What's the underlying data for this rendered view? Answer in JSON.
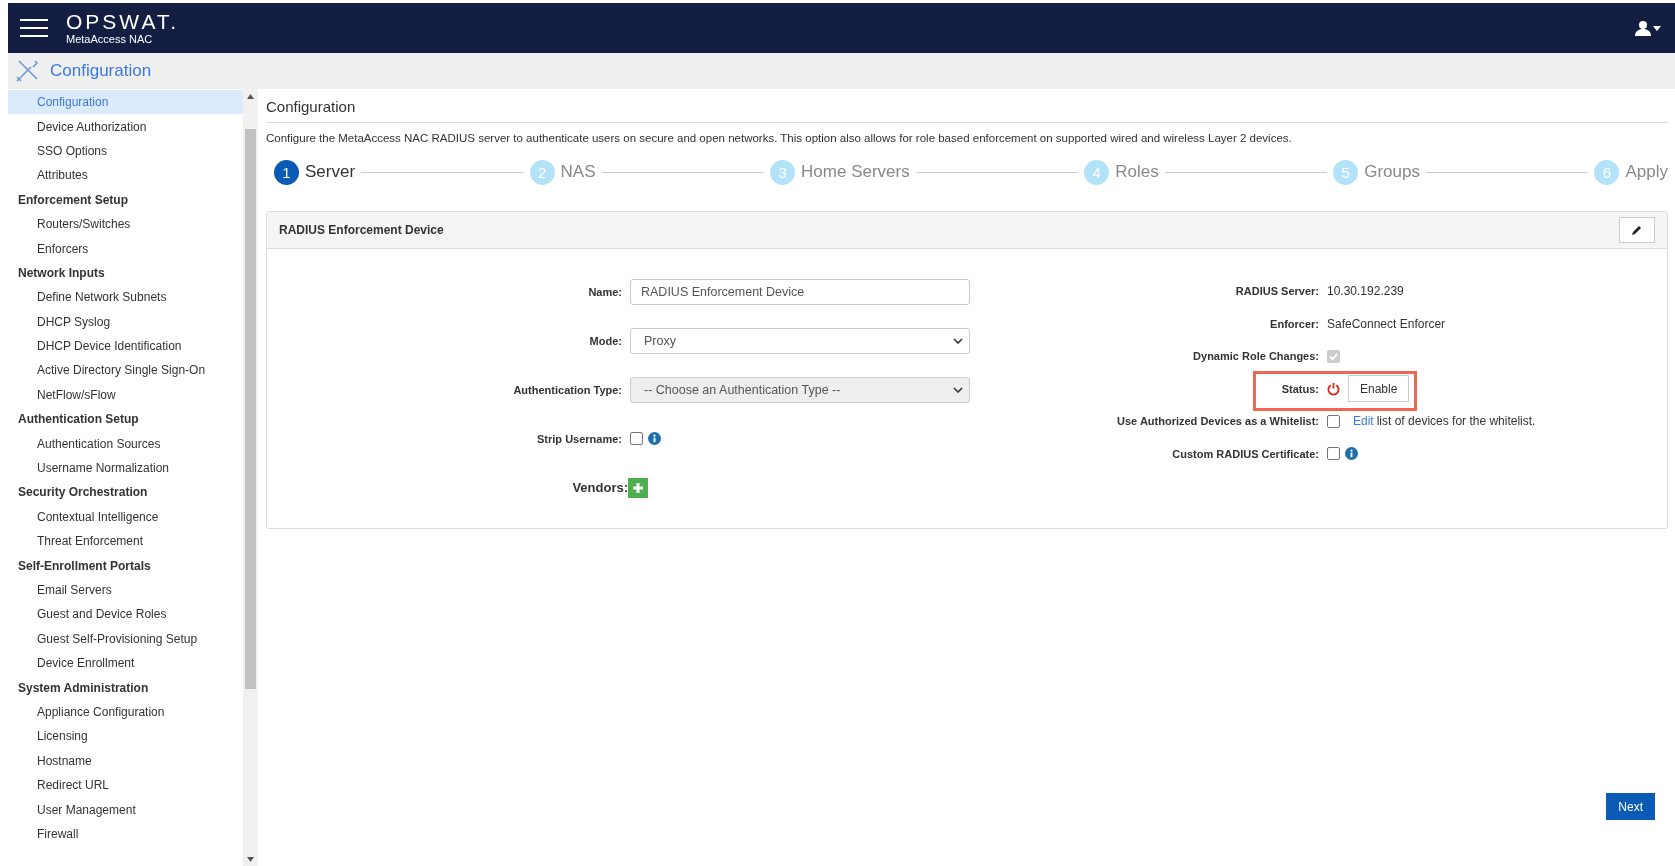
{
  "header": {
    "logo": "OPSWAT.",
    "product": "MetaAccess NAC"
  },
  "section_bar": {
    "title": "Configuration"
  },
  "sidebar": {
    "items": [
      {
        "kind": "item",
        "label": "Configuration",
        "selected": true
      },
      {
        "kind": "item",
        "label": "Device Authorization",
        "selected": false
      },
      {
        "kind": "item",
        "label": "SSO Options",
        "selected": false
      },
      {
        "kind": "item",
        "label": "Attributes",
        "selected": false
      },
      {
        "kind": "group",
        "label": "Enforcement Setup",
        "selected": false
      },
      {
        "kind": "item",
        "label": "Routers/Switches",
        "selected": false
      },
      {
        "kind": "item",
        "label": "Enforcers",
        "selected": false
      },
      {
        "kind": "group",
        "label": "Network Inputs",
        "selected": false
      },
      {
        "kind": "item",
        "label": "Define Network Subnets",
        "selected": false
      },
      {
        "kind": "item",
        "label": "DHCP Syslog",
        "selected": false
      },
      {
        "kind": "item",
        "label": "DHCP Device Identification",
        "selected": false
      },
      {
        "kind": "item",
        "label": "Active Directory Single Sign-On",
        "selected": false
      },
      {
        "kind": "item",
        "label": "NetFlow/sFlow",
        "selected": false
      },
      {
        "kind": "group",
        "label": "Authentication Setup",
        "selected": false
      },
      {
        "kind": "item",
        "label": "Authentication Sources",
        "selected": false
      },
      {
        "kind": "item",
        "label": "Username Normalization",
        "selected": false
      },
      {
        "kind": "group",
        "label": "Security Orchestration",
        "selected": false
      },
      {
        "kind": "item",
        "label": "Contextual Intelligence",
        "selected": false
      },
      {
        "kind": "item",
        "label": "Threat Enforcement",
        "selected": false
      },
      {
        "kind": "group",
        "label": "Self-Enrollment Portals",
        "selected": false
      },
      {
        "kind": "item",
        "label": "Email Servers",
        "selected": false
      },
      {
        "kind": "item",
        "label": "Guest and Device Roles",
        "selected": false
      },
      {
        "kind": "item",
        "label": "Guest Self-Provisioning Setup",
        "selected": false
      },
      {
        "kind": "item",
        "label": "Device Enrollment",
        "selected": false
      },
      {
        "kind": "group",
        "label": "System Administration",
        "selected": false
      },
      {
        "kind": "item",
        "label": "Appliance Configuration",
        "selected": false
      },
      {
        "kind": "item",
        "label": "Licensing",
        "selected": false
      },
      {
        "kind": "item",
        "label": "Hostname",
        "selected": false
      },
      {
        "kind": "item",
        "label": "Redirect URL",
        "selected": false
      },
      {
        "kind": "item",
        "label": "User Management",
        "selected": false
      },
      {
        "kind": "item",
        "label": "Firewall",
        "selected": false
      }
    ]
  },
  "page": {
    "title": "Configuration",
    "description": "Configure the MetaAccess NAC RADIUS server to authenticate users on secure and open networks. This option also allows for role based enforcement on supported wired and wireless Layer 2 devices."
  },
  "steps": [
    {
      "number": "1",
      "label": "Server",
      "selected": true
    },
    {
      "number": "2",
      "label": "NAS",
      "selected": false
    },
    {
      "number": "3",
      "label": "Home Servers",
      "selected": false
    },
    {
      "number": "4",
      "label": "Roles",
      "selected": false
    },
    {
      "number": "5",
      "label": "Groups",
      "selected": false
    },
    {
      "number": "6",
      "label": "Apply",
      "selected": false
    }
  ],
  "card": {
    "title": "RADIUS Enforcement Device",
    "left_fields": [
      {
        "kind": "input",
        "label": "Name:",
        "value": "RADIUS Enforcement Device"
      },
      {
        "kind": "select",
        "label": "Mode:",
        "value": "Proxy",
        "disabled": false
      },
      {
        "kind": "select",
        "label": "Authentication Type:",
        "value": "-- Choose an Authentication Type --",
        "disabled": true
      },
      {
        "kind": "checkbox",
        "label": "Strip Username:",
        "checked": false,
        "disabled": false,
        "info": true
      },
      {
        "kind": "add",
        "label": "Vendors:"
      }
    ],
    "right_fields": [
      {
        "kind": "text",
        "label": "RADIUS Server:",
        "value": "10.30.192.239"
      },
      {
        "kind": "text",
        "label": "Enforcer:",
        "value": "SafeConnect Enforcer"
      },
      {
        "kind": "checkbox",
        "label": "Dynamic Role Changes:",
        "checked": true,
        "disabled": true,
        "info": false
      },
      {
        "kind": "status",
        "label": "Status:",
        "button": "Enable",
        "on": false,
        "highlighted": true
      },
      {
        "kind": "checkbox",
        "label": "Use Authorized Devices as a Whitelist:",
        "checked": false,
        "disabled": false,
        "info": false,
        "link": "Edit",
        "text": "list of devices for the whitelist."
      },
      {
        "kind": "checkbox",
        "label": "Custom RADIUS Certificate:",
        "checked": false,
        "disabled": false,
        "info": true
      }
    ]
  },
  "next_button": "Next"
}
